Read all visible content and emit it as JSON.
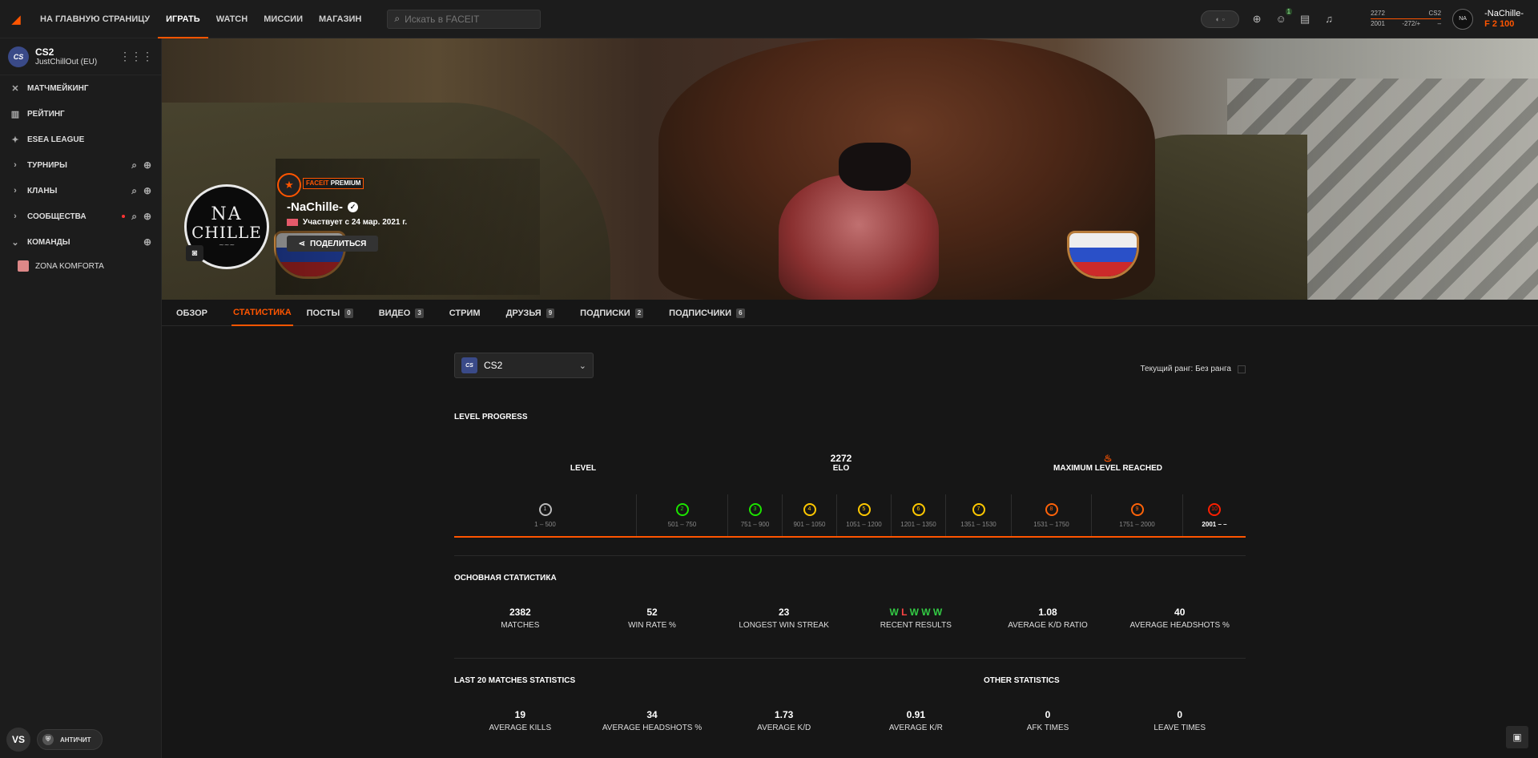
{
  "topbar": {
    "nav": [
      "НА ГЛАВНУЮ СТРАНИЦУ",
      "ИГРАТЬ",
      "WATCH",
      "МИССИИ",
      "МАГАЗИН"
    ],
    "active_nav": "ИГРАТЬ",
    "search_placeholder": "Искать в FACEIT",
    "friends_badge": "1",
    "elo": {
      "value": "2272",
      "low": "2001",
      "delta": "-272/+",
      "game": "CS2",
      "high": "–"
    },
    "username": "-NaChille-",
    "points": "2 100"
  },
  "sidebar": {
    "game": "CS2",
    "server": "JustChillOut (EU)",
    "items": [
      {
        "label": "МАТЧМЕЙКИНГ",
        "icon": "crossed-swords-icon"
      },
      {
        "label": "РЕЙТИНГ",
        "icon": "ranking-icon"
      },
      {
        "label": "ESEA LEAGUE",
        "icon": "star-icon"
      },
      {
        "label": "ТУРНИРЫ",
        "icon": "chevron-right-icon"
      },
      {
        "label": "КЛАНЫ",
        "icon": "chevron-right-icon"
      },
      {
        "label": "СООБЩЕСТВА",
        "icon": "chevron-right-icon"
      },
      {
        "label": "КОМАНДЫ",
        "icon": "chevron-down-icon"
      }
    ],
    "team": "ZONA KOMFORTA",
    "vs_label": "VS",
    "anticheat_label": "АНТИЧИТ"
  },
  "profile": {
    "premium_prefix": "FACEIT",
    "premium_suffix": "PREMIUM",
    "name": "-NaChille-",
    "since": "Участвует с 24 мар. 2021 г.",
    "share": "ПОДЕЛИТЬСЯ",
    "avatar_line1": "NA",
    "avatar_line2": "CHILLE"
  },
  "tabs": [
    {
      "label": "ОБЗОР",
      "count": ""
    },
    {
      "label": "СТАТИСТИКА",
      "count": ""
    },
    {
      "label": "ПОСТЫ",
      "count": "0"
    },
    {
      "label": "ВИДЕО",
      "count": "3"
    },
    {
      "label": "СТРИМ",
      "count": ""
    },
    {
      "label": "ДРУЗЬЯ",
      "count": "9"
    },
    {
      "label": "ПОДПИСКИ",
      "count": "2"
    },
    {
      "label": "ПОДПИСЧИКИ",
      "count": "6"
    }
  ],
  "stats_page": {
    "game_select": "CS2",
    "current_rank": "Текущий ранг: Без ранга",
    "level_progress_title": "LEVEL PROGRESS",
    "level_label": "LEVEL",
    "elo_value": "2272",
    "elo_label": "ELO",
    "max_level": "MAXIMUM LEVEL REACHED",
    "levels": [
      {
        "n": "1",
        "range": "1 – 500",
        "color": "#bbbbbb",
        "width": 0.23
      },
      {
        "n": "2",
        "range": "501 – 750",
        "color": "#1ce400",
        "width": 0.115
      },
      {
        "n": "3",
        "range": "751 – 900",
        "color": "#1ce400",
        "width": 0.069
      },
      {
        "n": "4",
        "range": "901 – 1050",
        "color": "#ffc800",
        "width": 0.069
      },
      {
        "n": "5",
        "range": "1051 – 1200",
        "color": "#ffc800",
        "width": 0.069
      },
      {
        "n": "6",
        "range": "1201 – 1350",
        "color": "#ffc800",
        "width": 0.069
      },
      {
        "n": "7",
        "range": "1351 – 1530",
        "color": "#ffc800",
        "width": 0.083
      },
      {
        "n": "8",
        "range": "1531 – 1750",
        "color": "#ff6309",
        "width": 0.101
      },
      {
        "n": "9",
        "range": "1751 – 2000",
        "color": "#ff6309",
        "width": 0.115
      },
      {
        "n": "10",
        "range": "2001 – –",
        "color": "#fe1f00",
        "width": 0.08,
        "current": true
      }
    ],
    "main_title": "ОСНОВНАЯ СТАТИСТИКА",
    "main_stats": [
      {
        "value": "2382",
        "label": "MATCHES"
      },
      {
        "value": "52",
        "label": "WIN RATE %"
      },
      {
        "value": "23",
        "label": "LONGEST WIN STREAK"
      },
      {
        "value": "",
        "label": "RECENT RESULTS",
        "results": [
          "W",
          "L",
          "W",
          "W",
          "W"
        ]
      },
      {
        "value": "1.08",
        "label": "AVERAGE K/D RATIO"
      },
      {
        "value": "40",
        "label": "AVERAGE HEADSHOTS %"
      }
    ],
    "last20_title": "LAST 20 MATCHES STATISTICS",
    "other_title": "OTHER STATISTICS",
    "last20_stats": [
      {
        "value": "19",
        "label": "AVERAGE KILLS"
      },
      {
        "value": "34",
        "label": "AVERAGE HEADSHOTS %"
      },
      {
        "value": "1.73",
        "label": "AVERAGE K/D"
      },
      {
        "value": "0.91",
        "label": "AVERAGE K/R"
      },
      {
        "value": "0",
        "label": "AFK TIMES"
      },
      {
        "value": "0",
        "label": "LEAVE TIMES"
      }
    ]
  },
  "colors": {
    "accent": "#ff5500",
    "win": "#33cc44",
    "loss": "#ff4444"
  }
}
